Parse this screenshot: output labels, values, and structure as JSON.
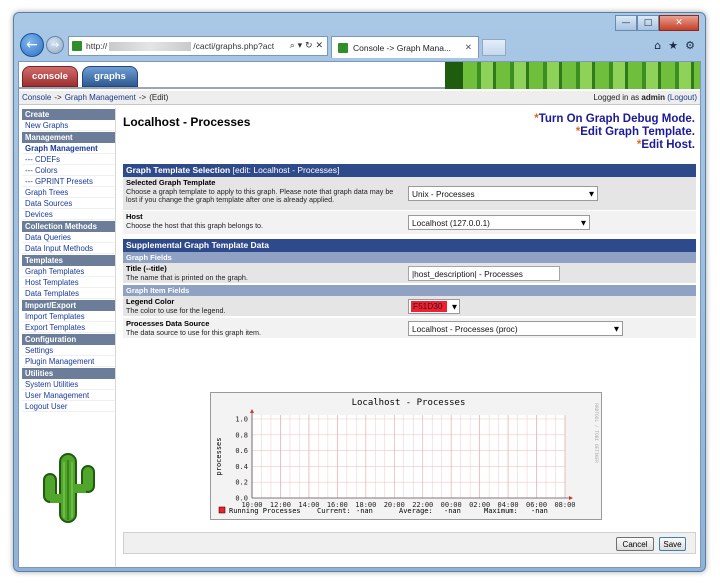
{
  "browser": {
    "address_prefix": "http://",
    "address_tail": "/cacti/graphs.php?act",
    "tab_title": "Console -> Graph Mana...",
    "address_icons": "⌕ ▾ ↻ ✕"
  },
  "header": {
    "tabs": [
      {
        "label": "console"
      },
      {
        "label": "graphs"
      }
    ]
  },
  "breadcrumb": {
    "console": "Console",
    "sep1": "->",
    "graph_management": "Graph Management",
    "sep2": "->",
    "edit": "(Edit)",
    "login_prefix": "Logged in as",
    "user": "admin",
    "logout": "(Logout)"
  },
  "sidebar": {
    "sections": [
      {
        "head": "Create",
        "items": [
          {
            "label": "New Graphs"
          }
        ]
      },
      {
        "head": "Management",
        "items": [
          {
            "label": "Graph Management",
            "active": true
          },
          {
            "label": "--- CDEFs"
          },
          {
            "label": "--- Colors"
          },
          {
            "label": "--- GPRINT Presets"
          },
          {
            "label": "Graph Trees"
          },
          {
            "label": "Data Sources"
          },
          {
            "label": "Devices"
          }
        ]
      },
      {
        "head": "Collection Methods",
        "items": [
          {
            "label": "Data Queries"
          },
          {
            "label": "Data Input Methods"
          }
        ]
      },
      {
        "head": "Templates",
        "items": [
          {
            "label": "Graph Templates"
          },
          {
            "label": "Host Templates"
          },
          {
            "label": "Data Templates"
          }
        ]
      },
      {
        "head": "Import/Export",
        "items": [
          {
            "label": "Import Templates"
          },
          {
            "label": "Export Templates"
          }
        ]
      },
      {
        "head": "Configuration",
        "items": [
          {
            "label": "Settings"
          },
          {
            "label": "Plugin Management"
          }
        ]
      },
      {
        "head": "Utilities",
        "items": [
          {
            "label": "System Utilities"
          },
          {
            "label": "User Management"
          },
          {
            "label": "Logout User"
          }
        ]
      }
    ]
  },
  "main": {
    "title": "Localhost - Processes",
    "links": {
      "star": "*",
      "debug": "Turn On Graph Debug Mode.",
      "edit_template": "Edit Graph Template.",
      "edit_host": "Edit Host."
    },
    "section1": {
      "title": "Graph Template Selection",
      "edit": "[edit: Localhost - Processes]"
    },
    "template_field": {
      "label": "Selected Graph Template",
      "desc": "Choose a graph template to apply to this graph. Please note that graph data may be lost if you change the graph template after one is already applied.",
      "value": "Unix - Processes"
    },
    "host_field": {
      "label": "Host",
      "desc": "Choose the host that this graph belongs to.",
      "value": "Localhost (127.0.0.1)"
    },
    "section2": {
      "title": "Supplemental Graph Template Data"
    },
    "graph_fields_head": "Graph Fields",
    "title_field": {
      "label": "Title (--title)",
      "desc": "The name that is printed on the graph.",
      "value": "|host_description| - Processes"
    },
    "item_fields_head": "Graph Item Fields",
    "legend_color": {
      "label": "Legend Color",
      "desc": "The color to use for the legend.",
      "value": "F51D30",
      "hex": "#F51D30"
    },
    "ds_field": {
      "label": "Processes Data Source",
      "desc": "The data source to use for this graph item.",
      "value": "Localhost - Processes (proc)"
    },
    "buttons": {
      "cancel": "Cancel",
      "save": "Save"
    }
  },
  "chart_data": {
    "type": "line",
    "title": "Localhost - Processes",
    "ylabel": "processes",
    "side_text": "RRDTOOL / TOBI OETIKER",
    "x": [
      "10:00",
      "12:00",
      "14:00",
      "16:00",
      "18:00",
      "20:00",
      "22:00",
      "00:00",
      "02:00",
      "04:00",
      "06:00",
      "08:00"
    ],
    "yticks": [
      "0.0",
      "0.2",
      "0.4",
      "0.6",
      "0.8",
      "1.0"
    ],
    "ylim": [
      0,
      1.0
    ],
    "series": [
      {
        "name": "Running Processes",
        "values": [],
        "color": "#F51D30"
      }
    ],
    "legend": {
      "name": "Running Processes",
      "current_label": "Current:",
      "current": "-nan",
      "average_label": "Average:",
      "average": "-nan",
      "maximum_label": "Maximum:",
      "maximum": "-nan"
    },
    "grid": true
  }
}
